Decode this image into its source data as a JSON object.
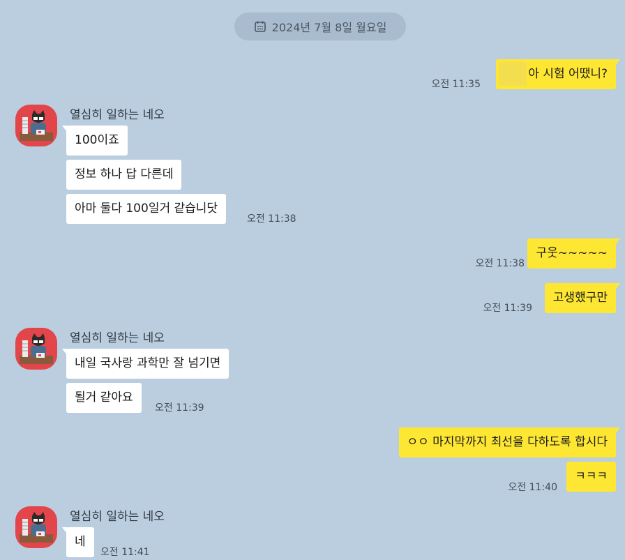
{
  "date_divider": {
    "text": "2024년 7월 8일 월요일",
    "icon": "calendar-icon"
  },
  "sender_name": "열심히 일하는 네오",
  "messages": [
    {
      "text": "아 시험 어땠니?",
      "time": "오전 11:35",
      "blurred_prefix": true
    },
    {
      "text": "100이죠"
    },
    {
      "text": "정보 하나 답 다른데"
    },
    {
      "text": "아마 둘다 100일거 같습니닷",
      "time": "오전 11:38"
    },
    {
      "text": "구웃~~~~~",
      "time": "오전 11:38"
    },
    {
      "text": "고생했구만",
      "time": "오전 11:39"
    },
    {
      "text": "내일 국사랑 과학만 잘 넘기면"
    },
    {
      "text": "될거 같아요",
      "time": "오전 11:39"
    },
    {
      "text": "ㅇㅇ 마지막까지 최선을 다하도록 합시다"
    },
    {
      "text": "ㅋㅋㅋ",
      "time": "오전 11:40"
    },
    {
      "text": "네",
      "time": "오전 11:41"
    }
  ],
  "colors": {
    "background": "#bacee0",
    "outgoing_bubble": "#fee733",
    "incoming_bubble": "#ffffff",
    "avatar": "#e2454a"
  }
}
